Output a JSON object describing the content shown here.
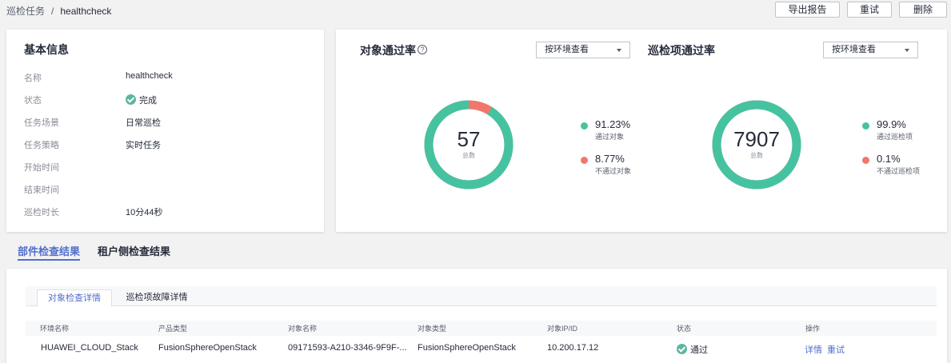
{
  "header": {
    "breadcrumb_parent": "巡检任务",
    "breadcrumb_separator": "/",
    "breadcrumb_current": "healthcheck",
    "buttons": {
      "export": "导出报告",
      "retry": "重试",
      "delete": "删除"
    }
  },
  "basic_info": {
    "title": "基本信息",
    "rows": [
      {
        "label": "名称",
        "value": "healthcheck"
      },
      {
        "label": "状态",
        "value": "完成"
      },
      {
        "label": "任务场景",
        "value": "日常巡检"
      },
      {
        "label": "任务策略",
        "value": "实时任务"
      },
      {
        "label": "开始时间",
        "value": ""
      },
      {
        "label": "结束时间",
        "value": ""
      },
      {
        "label": "巡检时长",
        "value": "10分44秒"
      }
    ]
  },
  "object_rate": {
    "title": "对象通过率",
    "help_icon": "?",
    "select_value": "按环境查看",
    "total": "57",
    "total_label": "总数",
    "pass_pct": "91.23%",
    "pass_label": "通过对象",
    "fail_pct": "8.77%",
    "fail_label": "不通过对象",
    "pass_fraction": 0.9123
  },
  "item_rate": {
    "title": "巡检项通过率",
    "select_value": "按环境查看",
    "total": "7907",
    "total_label": "总数",
    "pass_pct": "99.9%",
    "pass_label": "通过巡检项",
    "fail_pct": "0.1%",
    "fail_label": "不通过巡检项",
    "pass_fraction": 0.999
  },
  "colors": {
    "pass": "#45c3a0",
    "fail": "#f0776b",
    "accent": "#526ecc"
  },
  "result_tabs": {
    "component": "部件检查结果",
    "tenant": "租户侧检查结果"
  },
  "detail_tabs": {
    "object_detail": "对象检查详情",
    "item_fault": "巡检项故障详情"
  },
  "table": {
    "headers": [
      "环境名称",
      "产品类型",
      "对象名称",
      "对象类型",
      "对象IP/ID",
      "状态",
      "操作"
    ],
    "row": {
      "env": "HUAWEI_CLOUD_Stack",
      "product": "FusionSphereOpenStack",
      "object_name": "09171593-A210-3346-9F9F-...",
      "object_type": "FusionSphereOpenStack",
      "ip": "10.200.17.12",
      "status": "通过",
      "action_detail": "详情",
      "action_retry": "重试"
    }
  }
}
